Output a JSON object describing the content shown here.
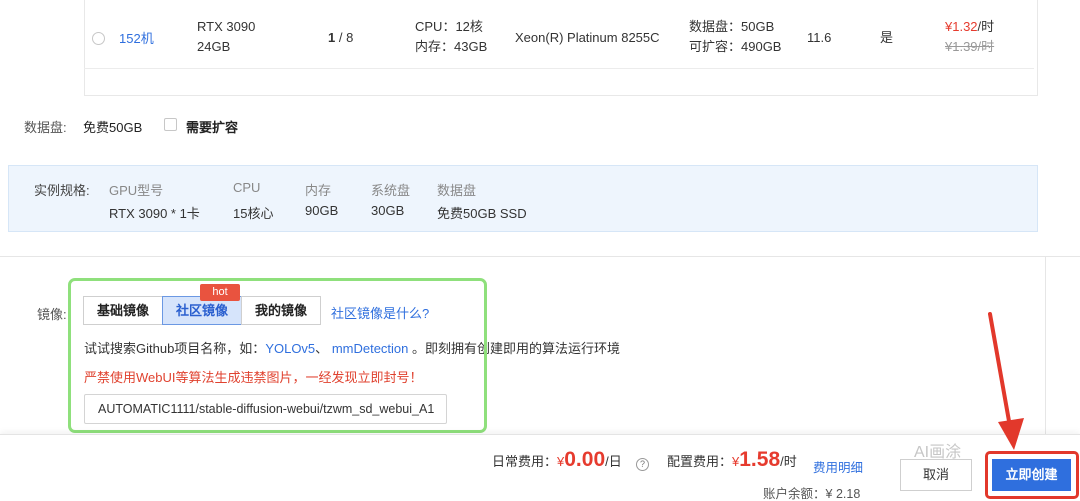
{
  "machine_row": {
    "name": "152机",
    "gpu_model": "RTX 3090",
    "gpu_mem": "24GB",
    "gpu_free": "1",
    "gpu_sep": " / ",
    "gpu_total": "8",
    "cpu": "CPU：12核",
    "memory": "内存：43GB",
    "cpu_model": "Xeon(R) Platinum 8255C",
    "data_disk": "数据盘：50GB",
    "expandable": "可扩容：490GB",
    "cuda": "11.6",
    "available": "是",
    "price_now": "¥1.32",
    "price_unit": "/时",
    "price_old": "¥1.39/时"
  },
  "data_disk": {
    "label": "数据盘:",
    "value": "免费50GB",
    "expand_label": "需要扩容"
  },
  "spec": {
    "label": "实例规格:",
    "columns": [
      {
        "head": "GPU型号",
        "value": "RTX 3090 * 1卡"
      },
      {
        "head": "CPU",
        "value": "15核心"
      },
      {
        "head": "内存",
        "value": "90GB"
      },
      {
        "head": "系统盘",
        "value": "30GB"
      },
      {
        "head": "数据盘",
        "value": "免费50GB SSD"
      }
    ]
  },
  "image": {
    "label": "镜像:",
    "tabs": [
      "基础镜像",
      "社区镜像",
      "我的镜像"
    ],
    "hot_badge": "hot",
    "what_link": "社区镜像是什么?",
    "hint_prefix": "试试搜索Github项目名称，如：",
    "hint_link1": "YOLOv5",
    "hint_sep": "、",
    "hint_link2": "mmDetection",
    "hint_suffix": "。即刻拥有创建即用的算法运行环境",
    "warning": "严禁使用WebUI等算法生成违禁图片，一经发现立即封号！",
    "selected_value": "AUTOMATIC1111/stable-diffusion-webui/tzwm_sd_webui_A1"
  },
  "footer": {
    "daily_label": "日常费用：",
    "daily_cur": "¥",
    "daily_value": "0.00",
    "daily_unit": "/日",
    "help": "?",
    "config_label": "配置费用：",
    "config_cur": "¥",
    "config_value": "1.58",
    "config_unit": "/时",
    "detail_link": "费用明细",
    "balance_label": "账户余额：",
    "balance_value": "¥ 2.18",
    "cancel": "取消",
    "create": "立即创建",
    "watermark": "AI画涂"
  },
  "colors": {
    "accent": "#2f6fde",
    "price": "#e63b2e",
    "highlight_green": "#8fe07c",
    "highlight_red": "#e2382b"
  }
}
